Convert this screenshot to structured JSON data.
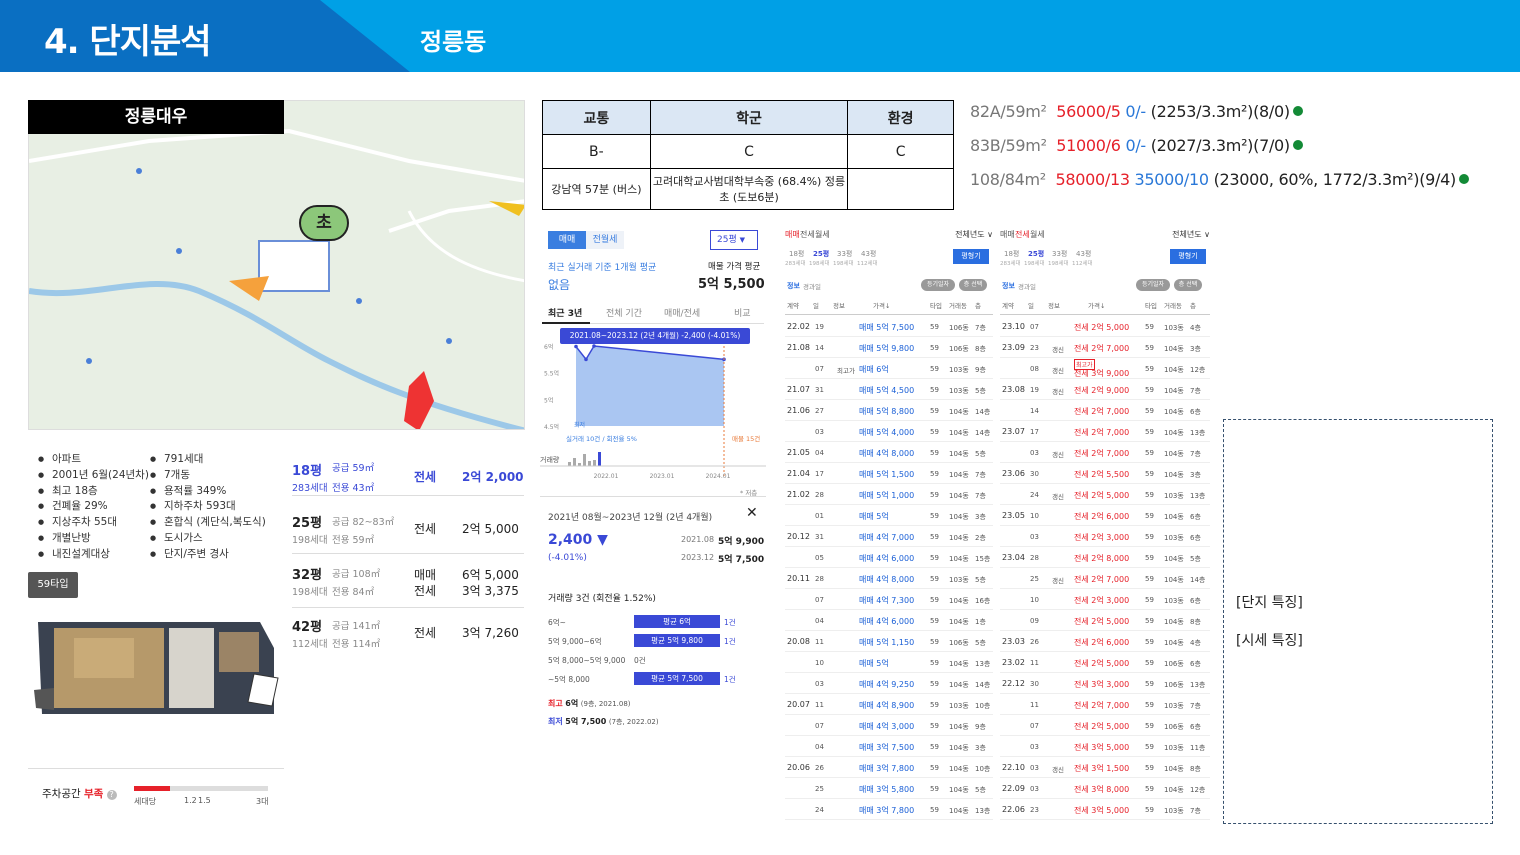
{
  "header": {
    "title": "4. 단지분석",
    "dong": "정릉동"
  },
  "complex": {
    "name": "정릉대우",
    "map_label": "초",
    "info_left": [
      "아파트",
      "2001년 6월(24년차)",
      "최고 18층",
      "건폐율 29%",
      "지상주차 55대",
      "개별난방",
      "내진설계대상"
    ],
    "info_right": [
      "791세대",
      "7개동",
      "용적률 349%",
      "지하주차 593대",
      "혼합식 (계단식,복도식)",
      "도시가스",
      "단지/주변 경사"
    ],
    "type_button": "59타입",
    "parking": {
      "label": "주차공간",
      "status": "부족",
      "per": "세대당",
      "t1": "1.2",
      "t2": "1.5",
      "t3": "3대"
    }
  },
  "pyeong_rows": [
    {
      "py": "18평",
      "supply": "공급 59㎡",
      "units": "283세대",
      "excl": "전용 43㎡",
      "type": "전세",
      "type2": "",
      "price": "2억 2,000",
      "price2": ""
    },
    {
      "py": "25평",
      "supply": "공급 82~83㎡",
      "units": "198세대",
      "excl": "전용 59㎡",
      "type": "전세",
      "type2": "",
      "price": "2억 5,000",
      "price2": ""
    },
    {
      "py": "32평",
      "supply": "공급 108㎡",
      "units": "198세대",
      "excl": "전용 84㎡",
      "type": "매매",
      "type2": "전세",
      "price": "6억 5,000",
      "price2": "3억 3,375"
    },
    {
      "py": "42평",
      "supply": "공급 141㎡",
      "units": "112세대",
      "excl": "전용 114㎡",
      "type": "전세",
      "type2": "",
      "price": "3억 7,260",
      "price2": ""
    }
  ],
  "grade": {
    "headers": [
      "교통",
      "학군",
      "환경"
    ],
    "grades": [
      "B-",
      "C",
      "C"
    ],
    "details": [
      "강남역 57분 (버스)",
      "고려대학교사범대학부속중 (68.4%) 정릉초 (도보6분)",
      ""
    ]
  },
  "listings": [
    {
      "type": "82A/59m²",
      "sale": "56000/5",
      "jeonse": "0/-",
      "rest": "(2253/3.3m²)(8/0)"
    },
    {
      "type": "83B/59m²",
      "sale": "51000/6",
      "jeonse": "0/-",
      "rest": "(2027/3.3m²)(7/0)"
    },
    {
      "type": "108/84m²",
      "sale": "58000/13",
      "jeonse": "35000/10",
      "rest": "(23000, 60%, 1772/3.3m²)(9/4)"
    }
  ],
  "price_panel": {
    "tab_sale": "매매",
    "tab_rent": "전월세",
    "size": "25평",
    "recent_label": "최근 실거래 기준 1개월 평균",
    "recent_value": "없음",
    "ask_label": "매물 가격 평균",
    "ask_value": "5억 5,500",
    "periods": [
      "최근 3년",
      "전체 기간",
      "매매/전세",
      "비교"
    ],
    "tooltip": "2021.08~2023.12 (2년 4개월) -2,400 (-4.01%)",
    "yticks": [
      "6억",
      "5.5억",
      "5억",
      "4.5억"
    ],
    "xticks": [
      "2022.01",
      "2023.01",
      "2024.01"
    ],
    "low_label": "최저",
    "left_note": "실거래 10건 / 회전율 5%",
    "right_note": "매물 15건",
    "volume_label": "거래량",
    "scale_note": "* 저층",
    "period_title": "2021년 08월~2023년 12월 (2년 4개월)",
    "change": "2,400 ▼",
    "change_pct": "(-4.01%)",
    "from_date": "2021.08",
    "from_price": "5억 9,900",
    "to_date": "2023.12",
    "to_price": "5억 7,500",
    "vol_title": "거래량 3건 (회전율 1.52%)",
    "bands": [
      {
        "label": "6억~",
        "bar": "평균 6억",
        "count": "1건"
      },
      {
        "label": "5억 9,000~6억",
        "bar": "평균 5억 9,800",
        "count": "1건"
      },
      {
        "label": "5억 8,000~5억 9,000",
        "bar": "",
        "count": "0건"
      },
      {
        "label": "~5억 8,000",
        "bar": "평균 5억 7,500",
        "count": "1건"
      }
    ],
    "max_label": "최고",
    "max_value": "6억",
    "max_note": "(9층, 2021.08)",
    "min_label": "최저",
    "min_value": "5억 7,500",
    "min_note": "(7층, 2022.02)"
  },
  "chart_data": {
    "type": "area",
    "x": [
      "2021.08",
      "2021.09",
      "2021.10",
      "2023.12"
    ],
    "values": [
      5.99,
      5.75,
      6.0,
      5.75
    ],
    "ylim": [
      4.5,
      6.0
    ],
    "title": "",
    "xlabel": "",
    "ylabel": ""
  },
  "tx_sale": {
    "tabs": [
      "매매",
      "전세",
      "월세"
    ],
    "filter": "전체년도 ∨",
    "sizes": [
      "18평",
      "25평",
      "33평",
      "43평"
    ],
    "units": [
      "283세대",
      "198세대",
      "198세대",
      "112세대"
    ],
    "compare": "평형기",
    "info": "정보",
    "search": "경과일",
    "btn1": "등기일자",
    "btn2": "층 선택",
    "cols": [
      "계약",
      "일",
      "정보",
      "가격↓",
      "타입",
      "거래동",
      "층"
    ],
    "rows": [
      [
        "22.02",
        "19",
        "",
        "매매 5억 7,500",
        "59",
        "106동",
        "7층"
      ],
      [
        "21.08",
        "14",
        "",
        "매매 5억 9,800",
        "59",
        "106동",
        "8층"
      ],
      [
        "",
        "07",
        "최고가",
        "매매 6억",
        "59",
        "103동",
        "9층"
      ],
      [
        "21.07",
        "31",
        "",
        "매매 5억 4,500",
        "59",
        "103동",
        "5층"
      ],
      [
        "21.06",
        "27",
        "",
        "매매 5억 8,800",
        "59",
        "104동",
        "14층"
      ],
      [
        "",
        "03",
        "",
        "매매 5억 4,000",
        "59",
        "104동",
        "14층"
      ],
      [
        "21.05",
        "04",
        "",
        "매매 4억 8,000",
        "59",
        "104동",
        "5층"
      ],
      [
        "21.04",
        "17",
        "",
        "매매 5억 1,500",
        "59",
        "104동",
        "7층"
      ],
      [
        "21.02",
        "28",
        "",
        "매매 5억 1,000",
        "59",
        "104동",
        "7층"
      ],
      [
        "",
        "01",
        "",
        "매매 5억",
        "59",
        "104동",
        "3층"
      ],
      [
        "20.12",
        "31",
        "",
        "매매 4억 7,000",
        "59",
        "104동",
        "2층"
      ],
      [
        "",
        "05",
        "",
        "매매 4억 6,000",
        "59",
        "104동",
        "15층"
      ],
      [
        "20.11",
        "28",
        "",
        "매매 4억 8,000",
        "59",
        "103동",
        "5층"
      ],
      [
        "",
        "07",
        "",
        "매매 4억 7,300",
        "59",
        "104동",
        "16층"
      ],
      [
        "",
        "04",
        "",
        "매매 4억 6,000",
        "59",
        "104동",
        "1층"
      ],
      [
        "20.08",
        "11",
        "",
        "매매 5억 1,150",
        "59",
        "106동",
        "5층"
      ],
      [
        "",
        "10",
        "",
        "매매 5억",
        "59",
        "104동",
        "13층"
      ],
      [
        "",
        "03",
        "",
        "매매 4억 9,250",
        "59",
        "104동",
        "14층"
      ],
      [
        "20.07",
        "11",
        "",
        "매매 4억 8,900",
        "59",
        "103동",
        "10층"
      ],
      [
        "",
        "07",
        "",
        "매매 4억 3,000",
        "59",
        "104동",
        "9층"
      ],
      [
        "",
        "04",
        "",
        "매매 3억 7,500",
        "59",
        "104동",
        "3층"
      ],
      [
        "20.06",
        "26",
        "",
        "매매 3억 7,800",
        "59",
        "104동",
        "10층"
      ],
      [
        "",
        "25",
        "",
        "매매 3억 5,800",
        "59",
        "104동",
        "5층"
      ],
      [
        "",
        "24",
        "",
        "매매 3억 7,800",
        "59",
        "104동",
        "13층"
      ]
    ]
  },
  "tx_jeonse": {
    "tabs": [
      "매매",
      "전세",
      "월세"
    ],
    "filter": "전체년도 ∨",
    "sizes": [
      "18평",
      "25평",
      "33평",
      "43평"
    ],
    "units": [
      "283세대",
      "198세대",
      "198세대",
      "112세대"
    ],
    "compare": "평형기",
    "info": "정보",
    "search": "경과일",
    "btn1": "등기일자",
    "btn2": "층 선택",
    "cols": [
      "계약",
      "일",
      "정보",
      "가격↓",
      "타입",
      "거래동",
      "층"
    ],
    "rows": [
      [
        "23.10",
        "07",
        "",
        "전세 2억 5,000",
        "59",
        "103동",
        "4층"
      ],
      [
        "23.09",
        "23",
        "갱신",
        "전세 2억 7,000",
        "59",
        "104동",
        "3층"
      ],
      [
        "",
        "08",
        "갱신",
        "최고가|전세 3억 9,000",
        "59",
        "104동",
        "12층"
      ],
      [
        "23.08",
        "19",
        "갱신",
        "전세 2억 9,000",
        "59",
        "104동",
        "7층"
      ],
      [
        "",
        "14",
        "",
        "전세 2억 7,000",
        "59",
        "104동",
        "6층"
      ],
      [
        "23.07",
        "17",
        "",
        "전세 2억 7,000",
        "59",
        "104동",
        "13층"
      ],
      [
        "",
        "03",
        "갱신",
        "전세 2억 7,000",
        "59",
        "104동",
        "7층"
      ],
      [
        "23.06",
        "30",
        "",
        "전세 2억 5,500",
        "59",
        "104동",
        "3층"
      ],
      [
        "",
        "24",
        "갱신",
        "전세 2억 5,000",
        "59",
        "103동",
        "13층"
      ],
      [
        "23.05",
        "10",
        "",
        "전세 2억 6,000",
        "59",
        "104동",
        "6층"
      ],
      [
        "",
        "03",
        "",
        "전세 2억 3,000",
        "59",
        "103동",
        "6층"
      ],
      [
        "23.04",
        "28",
        "",
        "전세 2억 8,000",
        "59",
        "104동",
        "5층"
      ],
      [
        "",
        "25",
        "갱신",
        "전세 2억 7,000",
        "59",
        "104동",
        "14층"
      ],
      [
        "",
        "10",
        "",
        "전세 2억 3,000",
        "59",
        "103동",
        "6층"
      ],
      [
        "",
        "09",
        "",
        "전세 2억 5,000",
        "59",
        "104동",
        "8층"
      ],
      [
        "23.03",
        "26",
        "",
        "전세 2억 6,000",
        "59",
        "104동",
        "4층"
      ],
      [
        "23.02",
        "11",
        "",
        "전세 2억 5,000",
        "59",
        "106동",
        "6층"
      ],
      [
        "22.12",
        "30",
        "",
        "전세 3억 3,000",
        "59",
        "106동",
        "13층"
      ],
      [
        "",
        "11",
        "",
        "전세 2억 7,000",
        "59",
        "103동",
        "7층"
      ],
      [
        "",
        "07",
        "",
        "전세 2억 5,000",
        "59",
        "106동",
        "6층"
      ],
      [
        "",
        "03",
        "",
        "전세 3억 5,000",
        "59",
        "103동",
        "11층"
      ],
      [
        "22.10",
        "03",
        "갱신",
        "전세 3억 1,500",
        "59",
        "104동",
        "8층"
      ],
      [
        "22.09",
        "03",
        "",
        "전세 3억 8,000",
        "59",
        "104동",
        "12층"
      ],
      [
        "22.06",
        "23",
        "",
        "전세 3억 5,000",
        "59",
        "103동",
        "7층"
      ]
    ]
  },
  "notes": {
    "complex": "[단지 특징]",
    "market": "[시세 특징]"
  }
}
